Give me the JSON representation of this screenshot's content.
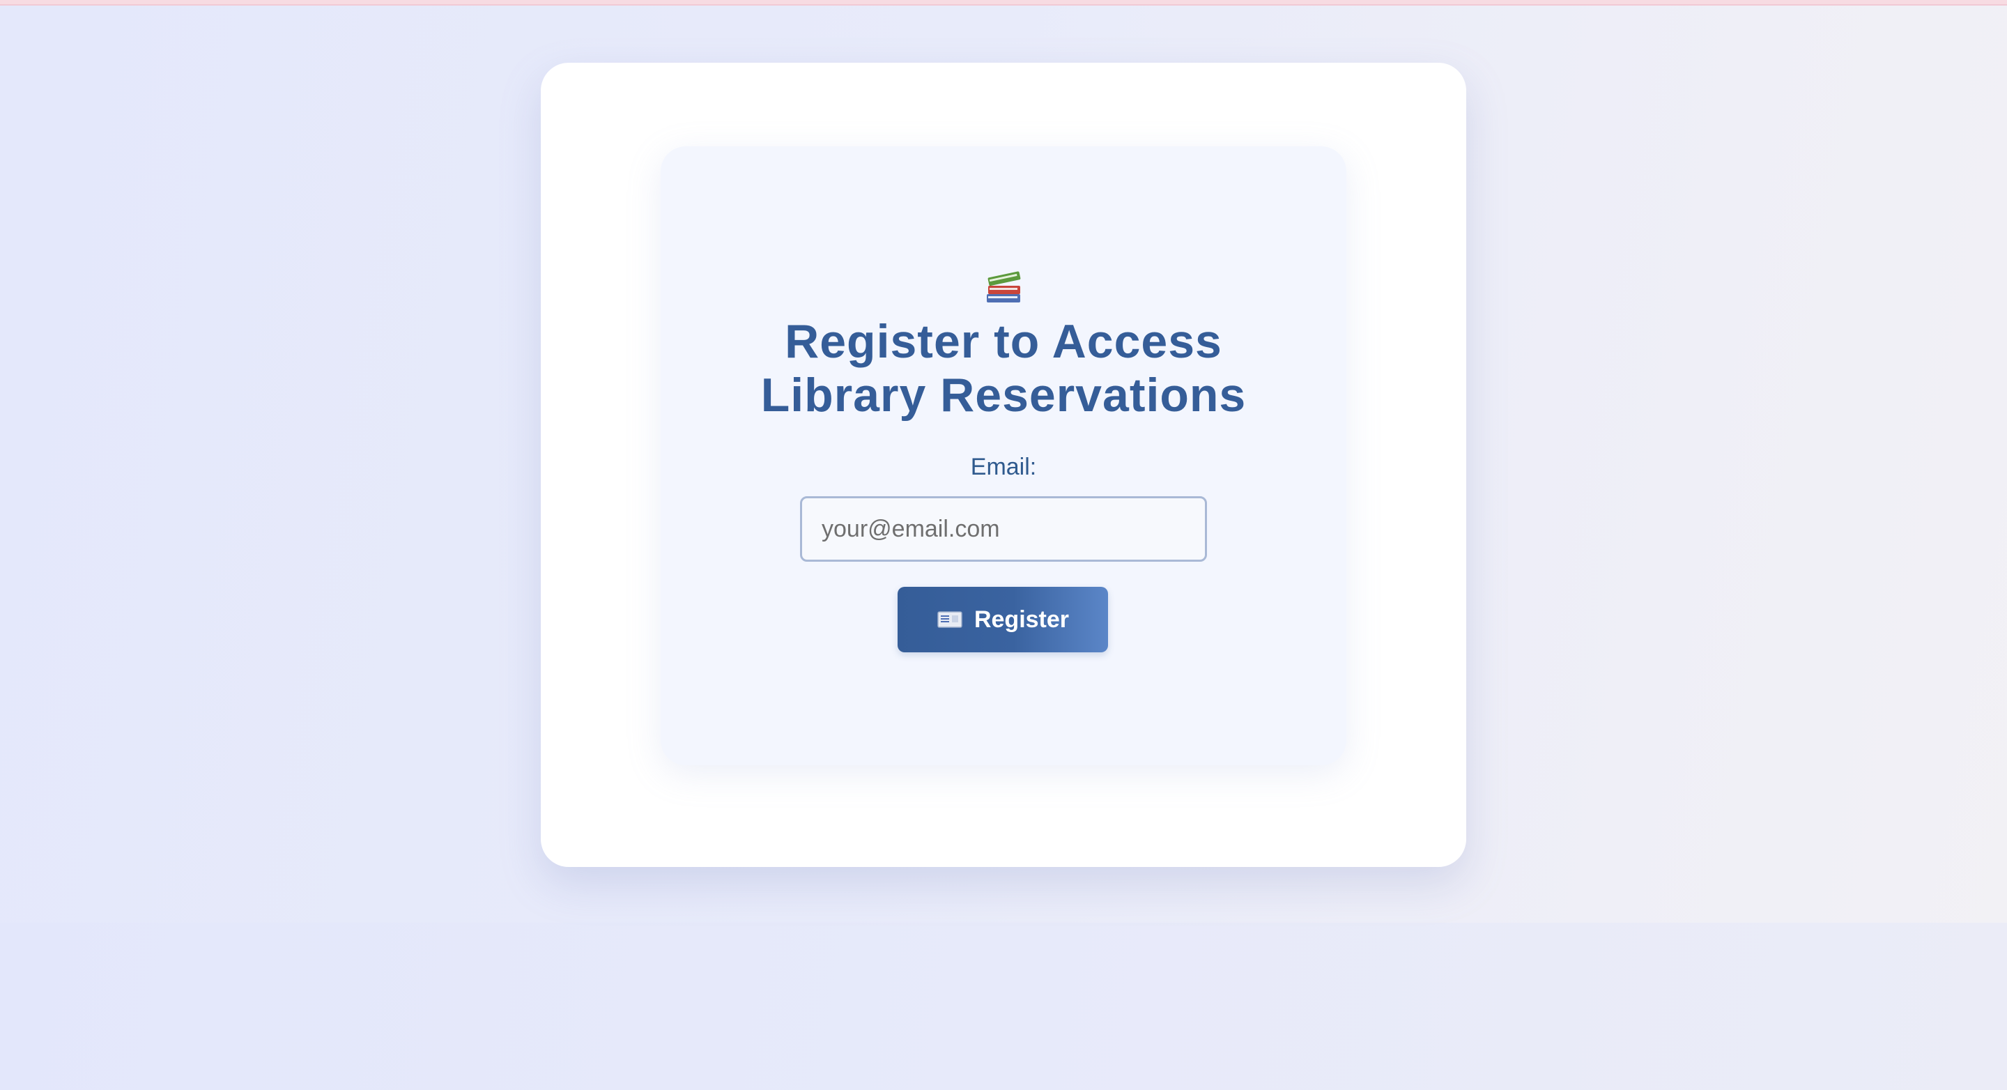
{
  "page": {
    "icon": "books-icon",
    "title": "Register to Access Library Reservations"
  },
  "form": {
    "email_label": "Email:",
    "email_placeholder": "your@email.com",
    "email_value": "",
    "submit_label": "Register",
    "submit_icon": "envelope-icon"
  },
  "colors": {
    "accent": "#355d98",
    "button_gradient_end": "#5b86c8",
    "card_background": "#ffffff",
    "inner_card_background": "#f3f6fe",
    "page_background": "#e6e9fa",
    "top_strip": "#f7dbe2"
  }
}
